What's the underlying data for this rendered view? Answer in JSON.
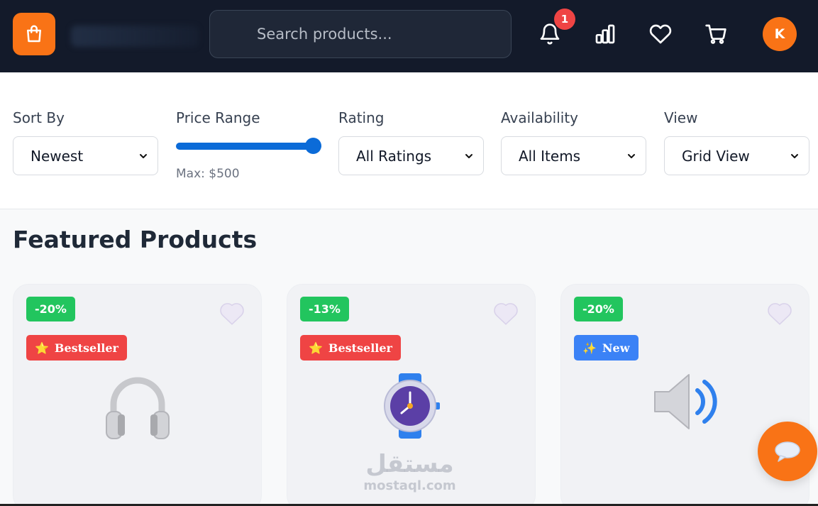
{
  "header": {
    "logo_icon": "shopping-bag-icon",
    "search_placeholder": "Search products...",
    "notifications_count": "1",
    "icons": [
      "bell-icon",
      "bar-chart-icon",
      "heart-icon",
      "cart-icon"
    ],
    "avatar_initial": "K"
  },
  "filters": {
    "sort": {
      "label": "Sort By",
      "value": "Newest"
    },
    "price": {
      "label": "Price Range",
      "max_text": "Max: $500",
      "level": 1.0
    },
    "rating": {
      "label": "Rating",
      "value": "All Ratings"
    },
    "availability": {
      "label": "Availability",
      "value": "All Items"
    },
    "view": {
      "label": "View",
      "value": "Grid View"
    }
  },
  "main": {
    "title": "Featured Products",
    "products": [
      {
        "discount": "-20%",
        "tag_icon": "⭐",
        "tag": "Bestseller",
        "tag_color": "#ef4444",
        "image": "headphones-icon"
      },
      {
        "discount": "-13%",
        "tag_icon": "⭐",
        "tag": "Bestseller",
        "tag_color": "#ef4444",
        "image": "watch-icon"
      },
      {
        "discount": "-20%",
        "tag_icon": "✨",
        "tag": "New",
        "tag_color": "#3b82f6",
        "image": "speaker-icon"
      }
    ]
  },
  "watermark": {
    "arabic": "مستقل",
    "latin": "mostaql.com"
  },
  "colors": {
    "accent": "#f97316",
    "header_bg": "#131a2a",
    "slider": "#0b6bd8",
    "discount": "#22c55e"
  }
}
